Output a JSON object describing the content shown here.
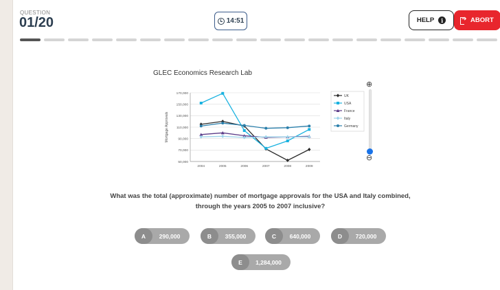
{
  "header": {
    "question_label": "QUESTION",
    "question_number": "01/20",
    "timer": "14:51",
    "help_label": "HELP",
    "abort_label": "ABORT",
    "progress_total": 20,
    "progress_current": 1
  },
  "chart_data": {
    "type": "line",
    "title": "GLEC Economics Research Lab",
    "ylabel": "Mortgage Approvals",
    "xlabel": "",
    "categories": [
      "2004",
      "2005",
      "2006",
      "2007",
      "2008",
      "2009"
    ],
    "ylim": [
      50000,
      170000
    ],
    "yticks": [
      "170,000",
      "150,000",
      "130,000",
      "110,000",
      "90,000",
      "70,000",
      "50,000"
    ],
    "legend_position": "right",
    "series": [
      {
        "name": "UK",
        "color": "#2b2b2b",
        "marker": "diamond",
        "values": [
          115000,
          120000,
          112000,
          72000,
          52000,
          71000
        ]
      },
      {
        "name": "USA",
        "color": "#1ab2e0",
        "marker": "square",
        "values": [
          152000,
          169000,
          104000,
          73000,
          86000,
          106000
        ]
      },
      {
        "name": "France",
        "color": "#5b3a87",
        "marker": "triangle",
        "values": [
          97000,
          100000,
          95000,
          92000,
          93000,
          94000
        ]
      },
      {
        "name": "Italy",
        "color": "#9dd3ea",
        "marker": "diamond",
        "values": [
          93000,
          94000,
          92000,
          93000,
          93000,
          93000
        ]
      },
      {
        "name": "Germany",
        "color": "#2a7fab",
        "marker": "circle",
        "values": [
          112000,
          117000,
          113000,
          108000,
          109000,
          112000
        ]
      }
    ]
  },
  "question": {
    "line1": "What was the total (approximate) number of mortgage approvals for the USA and Italy combined,",
    "line2": "through the years 2005 to 2007 inclusive?"
  },
  "options": [
    {
      "letter": "A",
      "value": "290,000"
    },
    {
      "letter": "B",
      "value": "355,000"
    },
    {
      "letter": "C",
      "value": "640,000"
    },
    {
      "letter": "D",
      "value": "720,000"
    },
    {
      "letter": "E",
      "value": "1,284,000"
    }
  ],
  "icons": {
    "timer": "clock-icon",
    "help": "info-icon",
    "abort": "exit-icon",
    "zoom_in": "zoom-in-icon",
    "zoom_out": "zoom-out-icon"
  },
  "colors": {
    "abort": "#e8262d",
    "timer_border": "#3b5b8a",
    "option_bg": "#a9a9a9",
    "zoom_knob": "#1a73e8"
  }
}
